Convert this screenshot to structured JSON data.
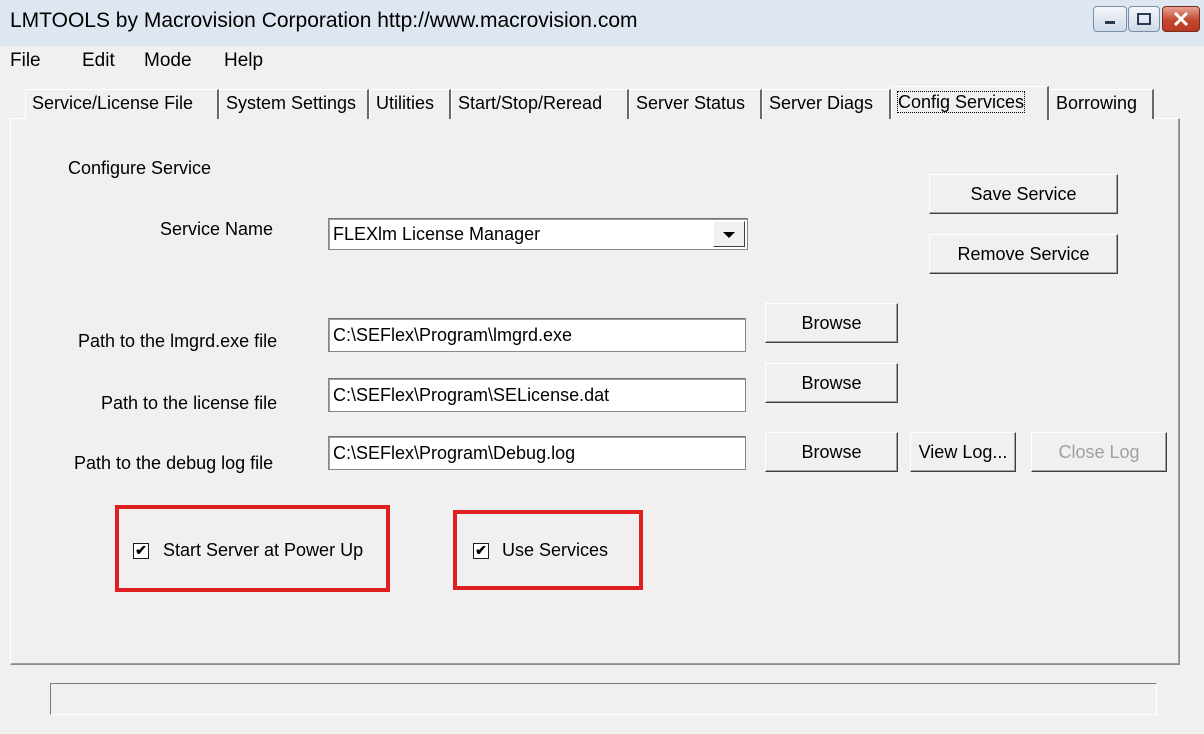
{
  "window": {
    "title": "LMTOOLS by Macrovision Corporation http://www.macrovision.com",
    "controls": [
      "minimize-icon",
      "maximize-icon",
      "close-icon"
    ],
    "close_color": "#c4472f"
  },
  "menu": {
    "items": [
      "File",
      "Edit",
      "Mode",
      "Help"
    ]
  },
  "tabs": [
    "Service/License File",
    "System Settings",
    "Utilities",
    "Start/Stop/Reread",
    "Server Status",
    "Server Diags",
    "Config Services",
    "Borrowing"
  ],
  "active_tab": "Config Services",
  "config": {
    "section_title": "Configure Service",
    "service_name_label": "Service Name",
    "service_name_value": "FLEXlm License Manager",
    "save_button": "Save Service",
    "remove_button": "Remove Service",
    "lmgrd_label": "Path to the lmgrd.exe file",
    "lmgrd_value": "C:\\SEFlex\\Program\\lmgrd.exe",
    "license_label": "Path to the license file",
    "license_value": "C:\\SEFlex\\Program\\SELicense.dat",
    "debug_label": "Path to the debug log file",
    "debug_value": "C:\\SEFlex\\Program\\Debug.log",
    "browse_label": "Browse",
    "view_log_button": "View Log...",
    "close_log_button": "Close Log",
    "start_server_label": "Start Server at Power Up",
    "start_server_checked": true,
    "use_services_label": "Use Services",
    "use_services_checked": true,
    "checkmark": "✔",
    "highlight_color": "#e02020"
  },
  "status_bar": {
    "text": ""
  }
}
